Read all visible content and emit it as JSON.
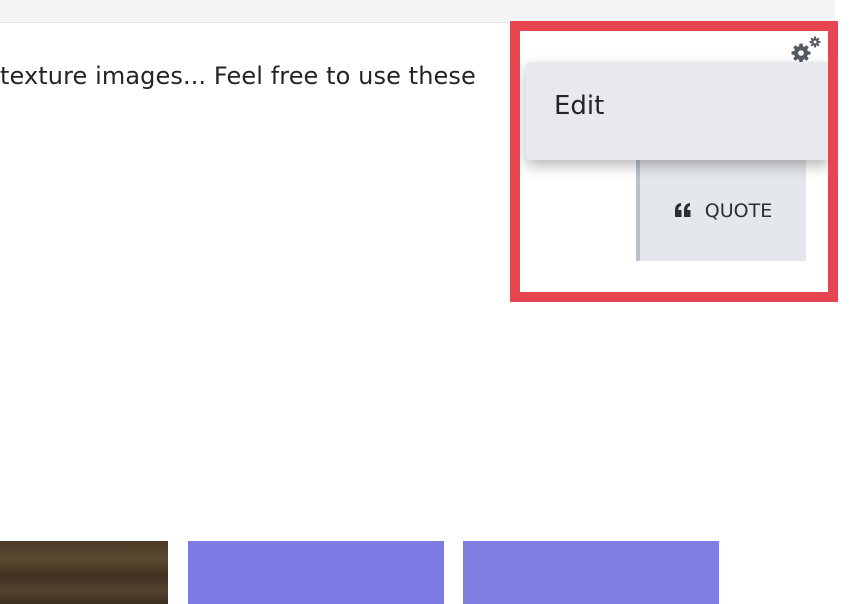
{
  "post": {
    "text": "texture images... Feel free to use these"
  },
  "actions_menu": {
    "icon": "gears-icon",
    "items": [
      {
        "label": "Edit"
      }
    ]
  },
  "quote_button": {
    "icon": "quote-icon",
    "label": "QUOTE"
  },
  "highlight": {
    "color": "#e5464f"
  },
  "thumbnails": [
    {
      "kind": "wood texture",
      "color": "#4a3a26"
    },
    {
      "kind": "normal map",
      "color": "#7e7ce4"
    },
    {
      "kind": "normal map",
      "color": "#7f7de2"
    }
  ]
}
